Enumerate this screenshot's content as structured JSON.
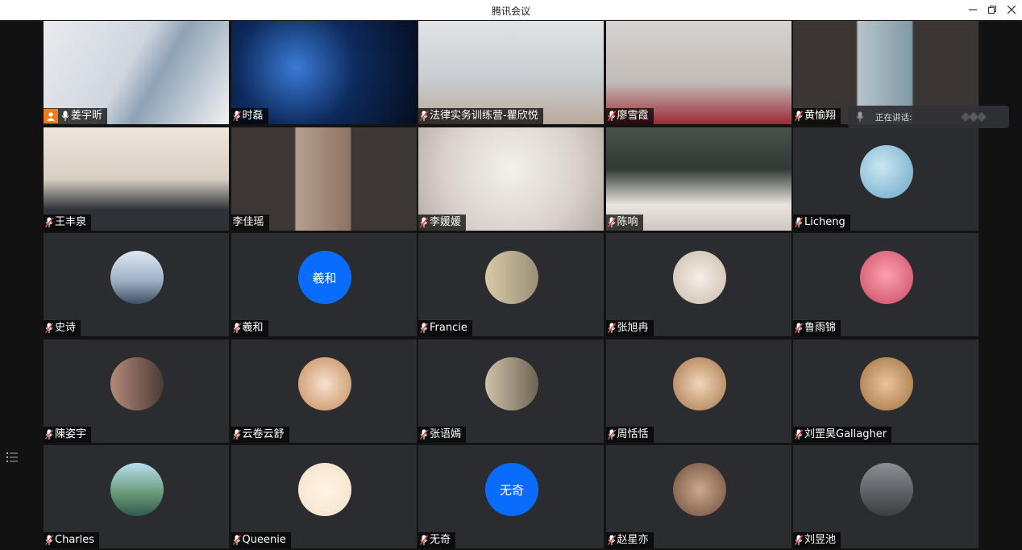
{
  "window": {
    "title": "腾讯会议",
    "minimize_icon": "minimize-icon",
    "restore_icon": "restore-icon",
    "close_icon": "close-icon"
  },
  "speaking_indicator": {
    "label": "正在讲话:",
    "speaker": ""
  },
  "participants": [
    {
      "name": "姜宇昕",
      "video": true,
      "host": true
    },
    {
      "name": "时磊",
      "video": true
    },
    {
      "name": "法律实务训练营-瞿欣悦",
      "video": true
    },
    {
      "name": "廖雪霞",
      "video": true
    },
    {
      "name": "黄愉翔",
      "video": true
    },
    {
      "name": "王丰泉",
      "video": true
    },
    {
      "name": "李佳瑶",
      "video": true,
      "no_mic": true
    },
    {
      "name": "李媛媛",
      "video": true
    },
    {
      "name": "陈响",
      "video": true
    },
    {
      "name": "Licheng",
      "video": false
    },
    {
      "name": "史诗",
      "video": false
    },
    {
      "name": "羲和",
      "video": false,
      "avatar_text": "羲和",
      "avatar_color": "#0a6cff"
    },
    {
      "name": "Francie",
      "video": false
    },
    {
      "name": "张旭冉",
      "video": false
    },
    {
      "name": "鲁雨锦",
      "video": false
    },
    {
      "name": "陳姿宇",
      "video": false
    },
    {
      "name": "云卷云舒",
      "video": false
    },
    {
      "name": "张语嫣",
      "video": false
    },
    {
      "name": "周恬恬",
      "video": false
    },
    {
      "name": "刘罡昊Gallagher",
      "video": false
    },
    {
      "name": "Charles",
      "video": false
    },
    {
      "name": "Queenie",
      "video": false
    },
    {
      "name": "无奇",
      "video": false,
      "avatar_text": "无奇",
      "avatar_color": "#0a6cff"
    },
    {
      "name": "赵星亦",
      "video": false
    },
    {
      "name": "刘昱池",
      "video": false
    }
  ],
  "colors": {
    "accent": "#0a6cff",
    "mic_muted": "#e5483f",
    "host_badge": "#f07b1c"
  }
}
